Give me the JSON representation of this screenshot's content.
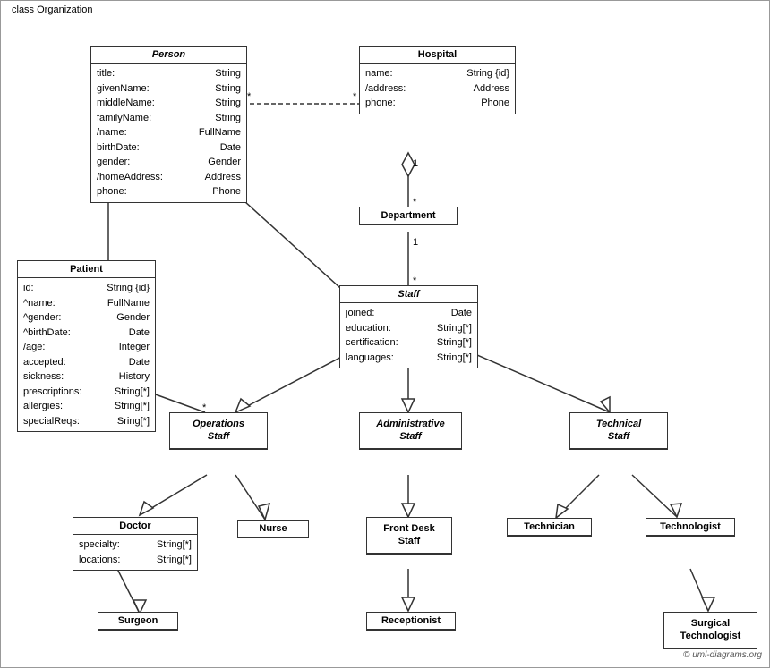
{
  "diagram": {
    "title": "class Organization",
    "classes": {
      "person": {
        "name": "Person",
        "italic": true,
        "attributes": [
          {
            "name": "title:",
            "type": "String"
          },
          {
            "name": "givenName:",
            "type": "String"
          },
          {
            "name": "middleName:",
            "type": "String"
          },
          {
            "name": "familyName:",
            "type": "String"
          },
          {
            "name": "/name:",
            "type": "FullName"
          },
          {
            "name": "birthDate:",
            "type": "Date"
          },
          {
            "name": "gender:",
            "type": "Gender"
          },
          {
            "name": "/homeAddress:",
            "type": "Address"
          },
          {
            "name": "phone:",
            "type": "Phone"
          }
        ]
      },
      "hospital": {
        "name": "Hospital",
        "italic": false,
        "attributes": [
          {
            "name": "name:",
            "type": "String {id}"
          },
          {
            "name": "/address:",
            "type": "Address"
          },
          {
            "name": "phone:",
            "type": "Phone"
          }
        ]
      },
      "department": {
        "name": "Department",
        "italic": false,
        "attributes": []
      },
      "staff": {
        "name": "Staff",
        "italic": true,
        "attributes": [
          {
            "name": "joined:",
            "type": "Date"
          },
          {
            "name": "education:",
            "type": "String[*]"
          },
          {
            "name": "certification:",
            "type": "String[*]"
          },
          {
            "name": "languages:",
            "type": "String[*]"
          }
        ]
      },
      "patient": {
        "name": "Patient",
        "italic": false,
        "attributes": [
          {
            "name": "id:",
            "type": "String {id}"
          },
          {
            "name": "^name:",
            "type": "FullName"
          },
          {
            "name": "^gender:",
            "type": "Gender"
          },
          {
            "name": "^birthDate:",
            "type": "Date"
          },
          {
            "name": "/age:",
            "type": "Integer"
          },
          {
            "name": "accepted:",
            "type": "Date"
          },
          {
            "name": "sickness:",
            "type": "History"
          },
          {
            "name": "prescriptions:",
            "type": "String[*]"
          },
          {
            "name": "allergies:",
            "type": "String[*]"
          },
          {
            "name": "specialReqs:",
            "type": "Sring[*]"
          }
        ]
      },
      "operations_staff": {
        "name": "Operations Staff",
        "italic": true
      },
      "administrative_staff": {
        "name": "Administrative Staff",
        "italic": true
      },
      "technical_staff": {
        "name": "Technical Staff",
        "italic": true
      },
      "doctor": {
        "name": "Doctor",
        "italic": false,
        "attributes": [
          {
            "name": "specialty:",
            "type": "String[*]"
          },
          {
            "name": "locations:",
            "type": "String[*]"
          }
        ]
      },
      "nurse": {
        "name": "Nurse",
        "italic": false
      },
      "front_desk_staff": {
        "name": "Front Desk Staff",
        "italic": false
      },
      "technician": {
        "name": "Technician",
        "italic": false
      },
      "technologist": {
        "name": "Technologist",
        "italic": false
      },
      "surgeon": {
        "name": "Surgeon",
        "italic": false
      },
      "receptionist": {
        "name": "Receptionist",
        "italic": false
      },
      "surgical_technologist": {
        "name": "Surgical Technologist",
        "italic": false
      }
    },
    "copyright": "© uml-diagrams.org"
  }
}
